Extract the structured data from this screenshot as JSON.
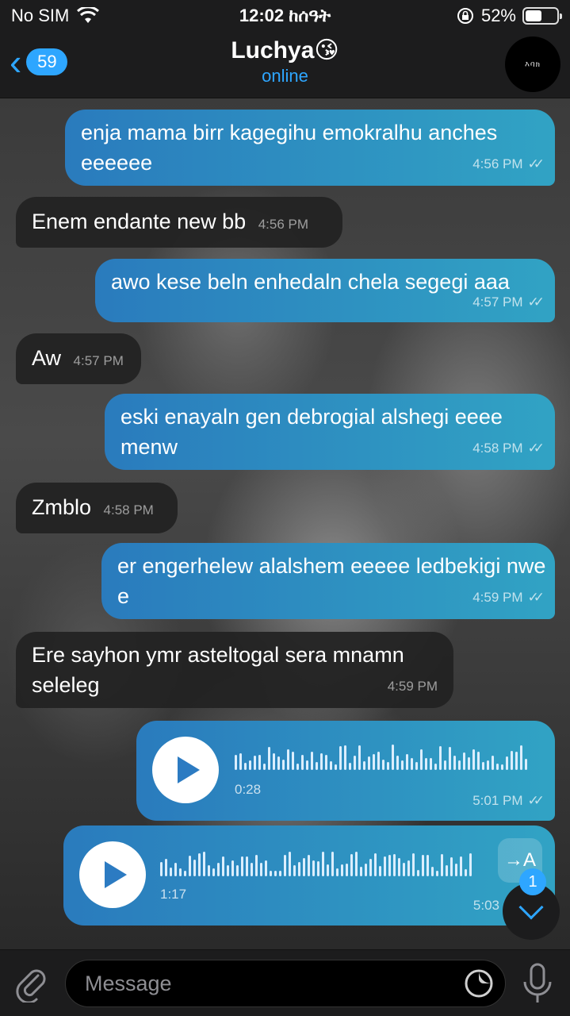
{
  "status_bar": {
    "carrier": "No SIM",
    "time": "12:02 ከሰዓት",
    "battery": "52%",
    "battery_level": 0.52,
    "icons": [
      "wifi-icon",
      "orientation-lock-icon",
      "battery-icon"
    ]
  },
  "header": {
    "back_count": "59",
    "title": "Luchya😘",
    "status": "online",
    "avatar_text": "እባክ"
  },
  "messages": [
    {
      "direction": "out",
      "text": "enja mama birr kagegihu emokralhu anches eeeeee",
      "time": "4:56 PM"
    },
    {
      "direction": "in",
      "text": "Enem endante new bb",
      "time": "4:56 PM"
    },
    {
      "direction": "out",
      "text": "awo kese beln enhedaln chela segegi aaa",
      "time": "4:57 PM"
    },
    {
      "direction": "in",
      "text": "Aw",
      "time": "4:57 PM"
    },
    {
      "direction": "out",
      "text": "eski enayaln gen debrogial alshegi eeee menw",
      "time": "4:58 PM"
    },
    {
      "direction": "in",
      "text": "Zmblo",
      "time": "4:58 PM"
    },
    {
      "direction": "out",
      "text": "er engerhelew alalshem eeeee ledbekigi nwe e",
      "time": "4:59 PM"
    },
    {
      "direction": "in",
      "text": "Ere sayhon ymr asteltogal sera mnamn seleleg",
      "time": "4:59 PM"
    }
  ],
  "voice_messages": [
    {
      "duration": "0:28",
      "time": "5:01 PM"
    },
    {
      "duration": "1:17",
      "time": "5:03",
      "translate_label": "→A"
    }
  ],
  "scroll_down_badge": "1",
  "input": {
    "placeholder": "Message"
  },
  "colors": {
    "accent": "#2ea6ff",
    "bar_bg": "#1c1c1d",
    "outgoing_start": "#2a7bbd",
    "outgoing_end": "#31a3c4",
    "incoming_bg": "#222222"
  }
}
